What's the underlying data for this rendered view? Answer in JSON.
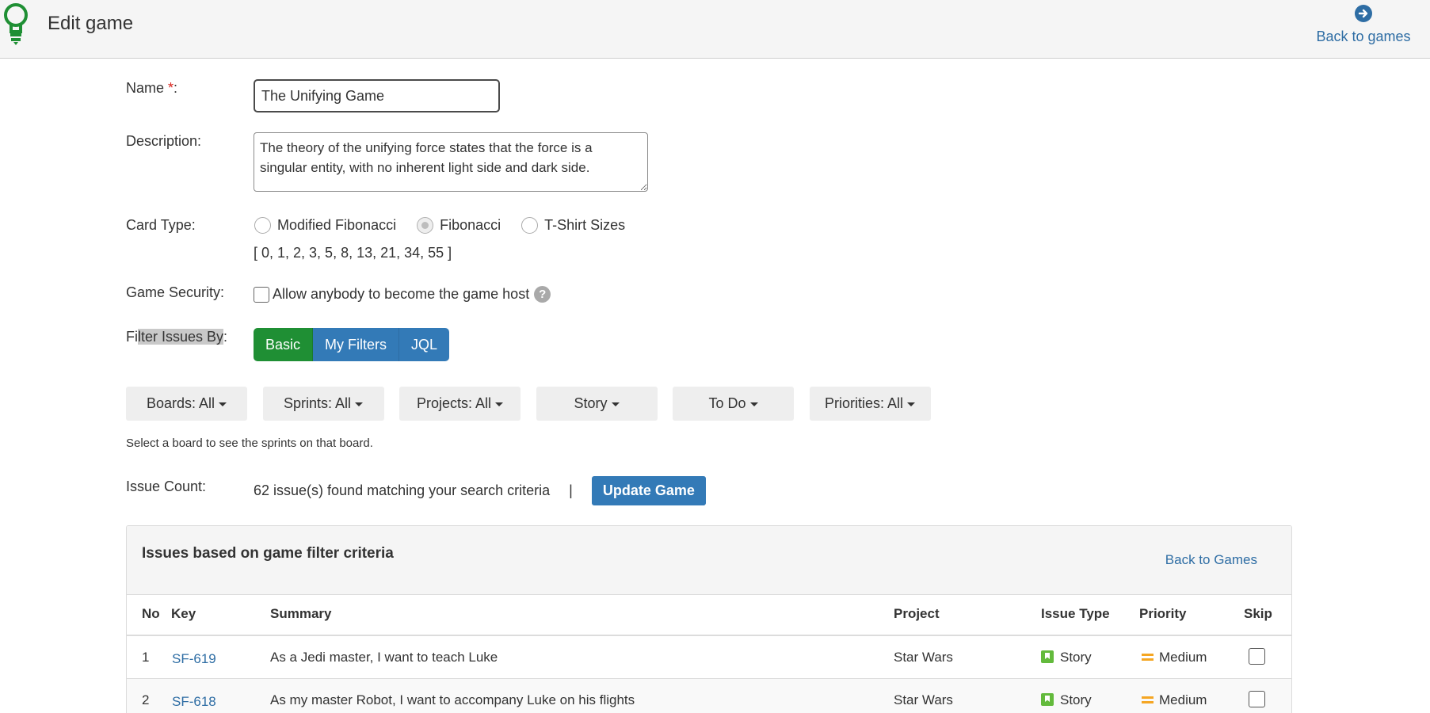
{
  "header": {
    "title": "Edit game",
    "back_link": "Back to games"
  },
  "form": {
    "name_label": "Name",
    "name_required": "*",
    "name_colon": ":",
    "name_value": "The Unifying Game",
    "description_label": "Description:",
    "description_value": "The theory of the unifying force states that the force is a singular entity, with no inherent light side and dark side.",
    "card_type_label": "Card Type:",
    "card_types": [
      {
        "label": "Modified Fibonacci",
        "checked": false
      },
      {
        "label": "Fibonacci",
        "checked": true
      },
      {
        "label": "T-Shirt Sizes",
        "checked": false
      }
    ],
    "card_values": "[ 0, 1, 2, 3, 5, 8, 13, 21, 34, 55 ]",
    "security_label": "Game Security:",
    "security_option": "Allow anybody to become the game host",
    "help_glyph": "?",
    "filter_label_pre": "Fi",
    "filter_label_hl": "lter Issues By",
    "filter_label_post": ":",
    "filter_modes": [
      "Basic",
      "My Filters",
      "JQL"
    ],
    "dropdowns": [
      "Boards: All",
      "Sprints: All",
      "Projects: All",
      "Story",
      "To Do",
      "Priorities: All"
    ],
    "help_text": "Select a board to see the sprints on that board.",
    "issue_count_label": "Issue Count:",
    "issue_count_text": "62 issue(s) found matching your search criteria",
    "separator": "|",
    "update_button": "Update Game"
  },
  "issues_panel": {
    "title": "Issues based on game filter criteria",
    "back_link": "Back to Games",
    "columns": [
      "No",
      "Key",
      "Summary",
      "Project",
      "Issue Type",
      "Priority",
      "Skip"
    ],
    "rows": [
      {
        "no": "1",
        "key": "SF-619",
        "summary": "As a Jedi master, I want to teach Luke",
        "project": "Star Wars",
        "issue_type": "Story",
        "priority": "Medium"
      },
      {
        "no": "2",
        "key": "SF-618",
        "summary": "As my master Robot, I want to accompany Luke on his flights",
        "project": "Star Wars",
        "issue_type": "Story",
        "priority": "Medium"
      }
    ]
  },
  "colors": {
    "brand_green": "#1f8f34",
    "primary_blue": "#337ab7",
    "link_blue": "#2e6da4",
    "story_green": "#63ba3c",
    "priority_orange": "#f5a623"
  },
  "icons": [
    "lightbulb-logo-icon",
    "arrow-circle-right-icon",
    "help-icon",
    "caret-down-icon",
    "story-icon",
    "priority-medium-icon"
  ]
}
